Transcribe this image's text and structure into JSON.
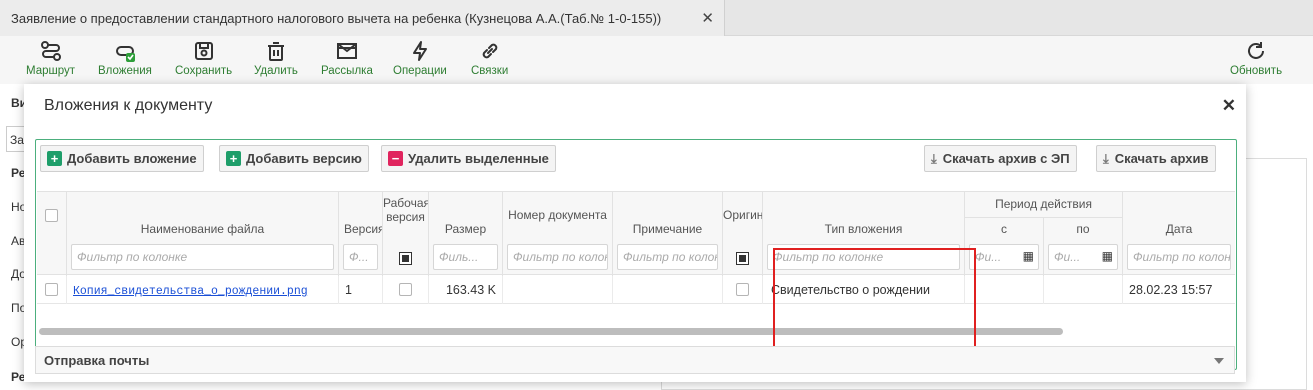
{
  "tab": {
    "title": "Заявление о предоставлении стандартного налогового вычета на ребенка (Кузнецова А.А.(Таб.№ 1-0-155))",
    "close": "✕"
  },
  "toolbar": {
    "route": "Маршрут",
    "attachments": "Вложения",
    "save": "Сохранить",
    "delete": "Удалить",
    "mailing": "Рассылка",
    "operations": "Операции",
    "links": "Связки",
    "refresh": "Обновить"
  },
  "background": {
    "l1": "Ви",
    "l2": "За",
    "l3": "Ре",
    "l4": "Но",
    "l5": "Ав",
    "l6": "До",
    "l7": "По",
    "l8": "Ор",
    "l9": "Ре"
  },
  "modal": {
    "title": "Вложения к документу",
    "close": "✕",
    "buttons": {
      "add_attachment": "Добавить вложение",
      "add_version": "Добавить версию",
      "delete_selected": "Удалить выделенные",
      "download_archive_ep": "Скачать архив с ЭП",
      "download_archive": "Скачать архив"
    },
    "columns": {
      "file_name": "Наименование файла",
      "version": "Версия",
      "working_version": "Рабочая версия",
      "size": "Размер",
      "doc_number": "Номер документа",
      "note": "Примечание",
      "original": "Оригинал",
      "attachment_type": "Тип вложения",
      "validity_period": "Период действия",
      "from": "с",
      "to": "по",
      "date": "Дата"
    },
    "filter_placeholder": "Фильтр по колонке",
    "filter_short": "Филь...",
    "filter_short2": "Фи...",
    "filter_v": "Ф...",
    "row": {
      "file_name": "Копия_свидетельства_о_рождении.png",
      "version": "1",
      "size": "163.43 K",
      "attachment_type": "Свидетельство о рождении",
      "date": "28.02.23 15:57"
    },
    "mail_section": "Отправка почты"
  },
  "colors": {
    "accent": "#2e7d32",
    "border_green": "#4caf7d",
    "highlight": "#e02020"
  }
}
